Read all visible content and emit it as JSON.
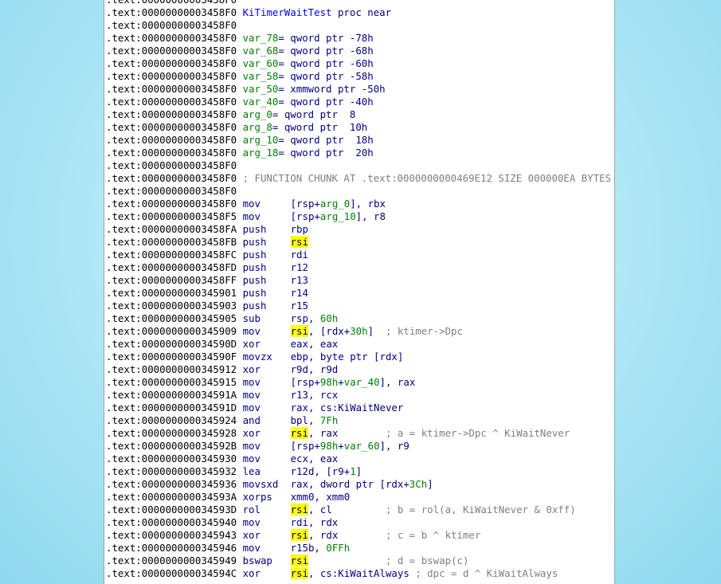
{
  "lines": [
    {
      "addr": ".text:00000000003458F0",
      "kind": "blank"
    },
    {
      "addr": ".text:00000000003458F0",
      "kind": "proc",
      "name": "KiTimerWaitTest",
      "rest": " proc near"
    },
    {
      "addr": ".text:00000000003458F0",
      "kind": "blank"
    },
    {
      "addr": ".text:00000000003458F0",
      "kind": "var",
      "name": "var_78",
      "decl": "= qword ptr -78h"
    },
    {
      "addr": ".text:00000000003458F0",
      "kind": "var",
      "name": "var_68",
      "decl": "= qword ptr -68h"
    },
    {
      "addr": ".text:00000000003458F0",
      "kind": "var",
      "name": "var_60",
      "decl": "= qword ptr -60h"
    },
    {
      "addr": ".text:00000000003458F0",
      "kind": "var",
      "name": "var_58",
      "decl": "= qword ptr -58h"
    },
    {
      "addr": ".text:00000000003458F0",
      "kind": "var",
      "name": "var_50",
      "decl": "= xmmword ptr -50h"
    },
    {
      "addr": ".text:00000000003458F0",
      "kind": "var",
      "name": "var_40",
      "decl": "= qword ptr -40h"
    },
    {
      "addr": ".text:00000000003458F0",
      "kind": "var",
      "name": "arg_0",
      "decl": "= qword ptr  8"
    },
    {
      "addr": ".text:00000000003458F0",
      "kind": "var",
      "name": "arg_8",
      "decl": "= qword ptr  10h"
    },
    {
      "addr": ".text:00000000003458F0",
      "kind": "var",
      "name": "arg_10",
      "decl": "= qword ptr  18h"
    },
    {
      "addr": ".text:00000000003458F0",
      "kind": "var",
      "name": "arg_18",
      "decl": "= qword ptr  20h"
    },
    {
      "addr": ".text:00000000003458F0",
      "kind": "blank"
    },
    {
      "addr": ".text:00000000003458F0",
      "kind": "comment",
      "text": "; FUNCTION CHUNK AT .text:0000000000469E12 SIZE 000000EA BYTES"
    },
    {
      "addr": ".text:00000000003458F0",
      "kind": "blank"
    },
    {
      "addr": ".text:00000000003458F0",
      "kind": "ins",
      "mn": "mov",
      "ops": [
        [
          "t",
          "[rsp+"
        ],
        [
          "s",
          "arg_0"
        ],
        [
          "t",
          "], rbx"
        ]
      ]
    },
    {
      "addr": ".text:00000000003458F5",
      "kind": "ins",
      "mn": "mov",
      "ops": [
        [
          "t",
          "[rsp+"
        ],
        [
          "s",
          "arg_10"
        ],
        [
          "t",
          "], r8"
        ]
      ]
    },
    {
      "addr": ".text:00000000003458FA",
      "kind": "ins",
      "mn": "push",
      "ops": [
        [
          "t",
          "rbp"
        ]
      ]
    },
    {
      "addr": ".text:00000000003458FB",
      "kind": "ins",
      "mn": "push",
      "ops": [
        [
          "h",
          "rsi"
        ]
      ]
    },
    {
      "addr": ".text:00000000003458FC",
      "kind": "ins",
      "mn": "push",
      "ops": [
        [
          "t",
          "rdi"
        ]
      ]
    },
    {
      "addr": ".text:00000000003458FD",
      "kind": "ins",
      "mn": "push",
      "ops": [
        [
          "t",
          "r12"
        ]
      ]
    },
    {
      "addr": ".text:00000000003458FF",
      "kind": "ins",
      "mn": "push",
      "ops": [
        [
          "t",
          "r13"
        ]
      ]
    },
    {
      "addr": ".text:0000000000345901",
      "kind": "ins",
      "mn": "push",
      "ops": [
        [
          "t",
          "r14"
        ]
      ]
    },
    {
      "addr": ".text:0000000000345903",
      "kind": "ins",
      "mn": "push",
      "ops": [
        [
          "t",
          "r15"
        ]
      ]
    },
    {
      "addr": ".text:0000000000345905",
      "kind": "ins",
      "mn": "sub",
      "ops": [
        [
          "t",
          "rsp, "
        ],
        [
          "n",
          "60h"
        ]
      ]
    },
    {
      "addr": ".text:0000000000345909",
      "kind": "ins",
      "mn": "mov",
      "ops": [
        [
          "h",
          "rsi"
        ],
        [
          "t",
          ", [rdx+"
        ],
        [
          "n",
          "30h"
        ],
        [
          "t",
          "]  "
        ],
        [
          "c",
          "; ktimer->Dpc"
        ]
      ]
    },
    {
      "addr": ".text:000000000034590D",
      "kind": "ins",
      "mn": "xor",
      "ops": [
        [
          "t",
          "eax, eax"
        ]
      ]
    },
    {
      "addr": ".text:000000000034590F",
      "kind": "ins",
      "mn": "movzx",
      "ops": [
        [
          "t",
          "ebp, byte ptr [rdx]"
        ]
      ]
    },
    {
      "addr": ".text:0000000000345912",
      "kind": "ins",
      "mn": "xor",
      "ops": [
        [
          "t",
          "r9d, r9d"
        ]
      ]
    },
    {
      "addr": ".text:0000000000345915",
      "kind": "ins",
      "mn": "mov",
      "ops": [
        [
          "t",
          "[rsp+"
        ],
        [
          "n",
          "98h"
        ],
        [
          "t",
          "+"
        ],
        [
          "s",
          "var_40"
        ],
        [
          "t",
          "], rax"
        ]
      ]
    },
    {
      "addr": ".text:000000000034591A",
      "kind": "ins",
      "mn": "mov",
      "ops": [
        [
          "t",
          "r13, rcx"
        ]
      ]
    },
    {
      "addr": ".text:000000000034591D",
      "kind": "ins",
      "mn": "mov",
      "ops": [
        [
          "t",
          "rax, cs:KiWaitNever"
        ]
      ]
    },
    {
      "addr": ".text:0000000000345924",
      "kind": "ins",
      "mn": "and",
      "ops": [
        [
          "t",
          "bpl, "
        ],
        [
          "n",
          "7Fh"
        ]
      ]
    },
    {
      "addr": ".text:0000000000345928",
      "kind": "ins",
      "mn": "xor",
      "ops": [
        [
          "h",
          "rsi"
        ],
        [
          "t",
          ", rax        "
        ],
        [
          "c",
          "; a = ktimer->Dpc ^ KiWaitNever"
        ]
      ]
    },
    {
      "addr": ".text:000000000034592B",
      "kind": "ins",
      "mn": "mov",
      "ops": [
        [
          "t",
          "[rsp+"
        ],
        [
          "n",
          "98h"
        ],
        [
          "t",
          "+"
        ],
        [
          "s",
          "var_60"
        ],
        [
          "t",
          "], r9"
        ]
      ]
    },
    {
      "addr": ".text:0000000000345930",
      "kind": "ins",
      "mn": "mov",
      "ops": [
        [
          "t",
          "ecx, eax"
        ]
      ]
    },
    {
      "addr": ".text:0000000000345932",
      "kind": "ins",
      "mn": "lea",
      "ops": [
        [
          "t",
          "r12d, [r9+"
        ],
        [
          "n",
          "1"
        ],
        [
          "t",
          "]"
        ]
      ]
    },
    {
      "addr": ".text:0000000000345936",
      "kind": "ins",
      "mn": "movsxd",
      "ops": [
        [
          "t",
          "rax, dword ptr [rdx+"
        ],
        [
          "n",
          "3Ch"
        ],
        [
          "t",
          "]"
        ]
      ]
    },
    {
      "addr": ".text:000000000034593A",
      "kind": "ins",
      "mn": "xorps",
      "ops": [
        [
          "t",
          "xmm0, xmm0"
        ]
      ]
    },
    {
      "addr": ".text:000000000034593D",
      "kind": "ins",
      "mn": "rol",
      "ops": [
        [
          "h",
          "rsi"
        ],
        [
          "t",
          ", cl         "
        ],
        [
          "c",
          "; b = rol(a, KiWaitNever & 0xff)"
        ]
      ]
    },
    {
      "addr": ".text:0000000000345940",
      "kind": "ins",
      "mn": "mov",
      "ops": [
        [
          "t",
          "rdi, rdx"
        ]
      ]
    },
    {
      "addr": ".text:0000000000345943",
      "kind": "ins",
      "mn": "xor",
      "ops": [
        [
          "h",
          "rsi"
        ],
        [
          "t",
          ", rdx        "
        ],
        [
          "c",
          "; c = b ^ ktimer"
        ]
      ]
    },
    {
      "addr": ".text:0000000000345946",
      "kind": "ins",
      "mn": "mov",
      "ops": [
        [
          "t",
          "r15b, "
        ],
        [
          "n",
          "0FFh"
        ]
      ]
    },
    {
      "addr": ".text:0000000000345949",
      "kind": "ins",
      "mn": "bswap",
      "ops": [
        [
          "h",
          "rsi"
        ],
        [
          "t",
          "             "
        ],
        [
          "c",
          "; d = bswap(c)"
        ]
      ]
    },
    {
      "addr": ".text:000000000034594C",
      "kind": "ins",
      "mn": "xor",
      "ops": [
        [
          "h",
          "rsi"
        ],
        [
          "t",
          ", cs:KiWaitAlways "
        ],
        [
          "c",
          "; dpc = d ^ KiWaitAlways"
        ]
      ]
    }
  ],
  "colors": {
    "instruction": "#000080",
    "symbol": "#007f00",
    "proc_name": "#0000ff",
    "comment": "#7f7f7f",
    "highlight": "#ffff00"
  }
}
